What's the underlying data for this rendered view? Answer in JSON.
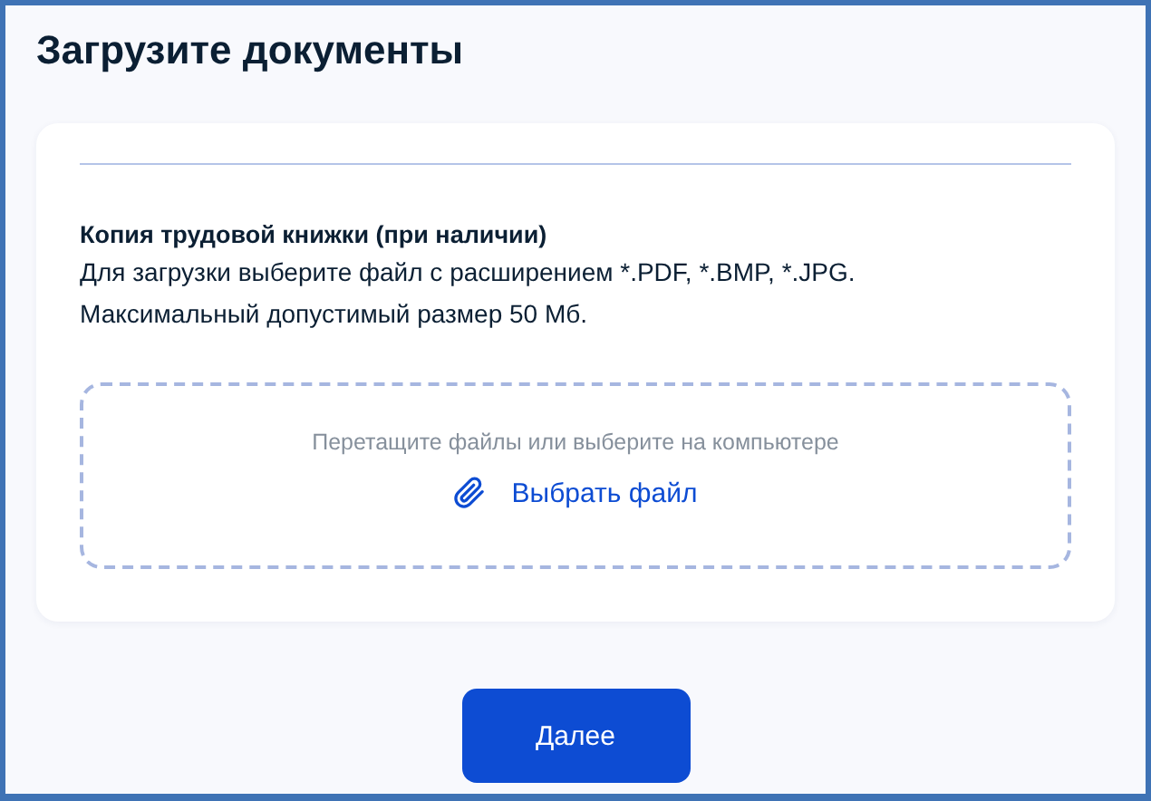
{
  "title": "Загрузите документы",
  "document": {
    "name": "Копия трудовой книжки (при наличии)",
    "lines": [
      "Для загрузки выберите файл с расширением *.PDF, *.BMP, *.JPG.",
      "Максимальный допустимый размер 50 Мб."
    ]
  },
  "dropzone": {
    "hint": "Перетащите файлы или выберите на компьютере",
    "link": "Выбрать файл"
  },
  "button": "Далее"
}
